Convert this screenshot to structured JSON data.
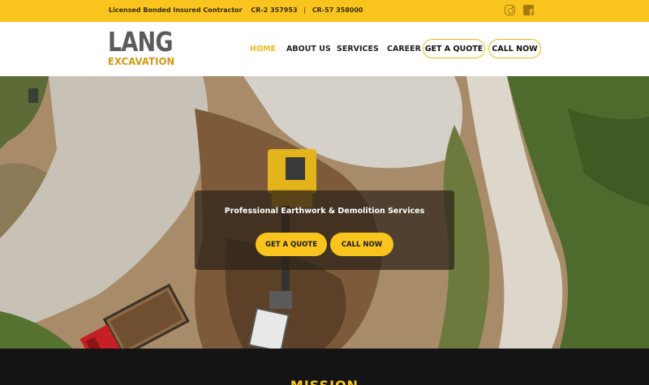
{
  "topbar": {
    "license_text": "Licensed Bonded Insured Contractor",
    "license_1": "CR-2 357953",
    "separator": "|",
    "license_2": "CR-57 358000",
    "social": [
      "instagram-icon",
      "facebook-icon"
    ],
    "facebook_glyph": "f"
  },
  "brand": {
    "logo_top": "LANG",
    "logo_bottom": "EXCAVATION"
  },
  "nav": {
    "home": "HOME",
    "about": "ABOUT US",
    "services": "SERVICES",
    "career": "CAREER",
    "quote_button": "GET A QUOTE",
    "call_button": "CALL NOW"
  },
  "hero": {
    "title": "Professional Earthwork & Demolition Services",
    "quote_button": "GET A QUOTE",
    "call_button": "CALL NOW"
  },
  "mission": {
    "title": "MISSION"
  },
  "colors": {
    "accent": "#f8c41d",
    "nav_active": "#f0b91a",
    "dark_band": "#141414"
  }
}
